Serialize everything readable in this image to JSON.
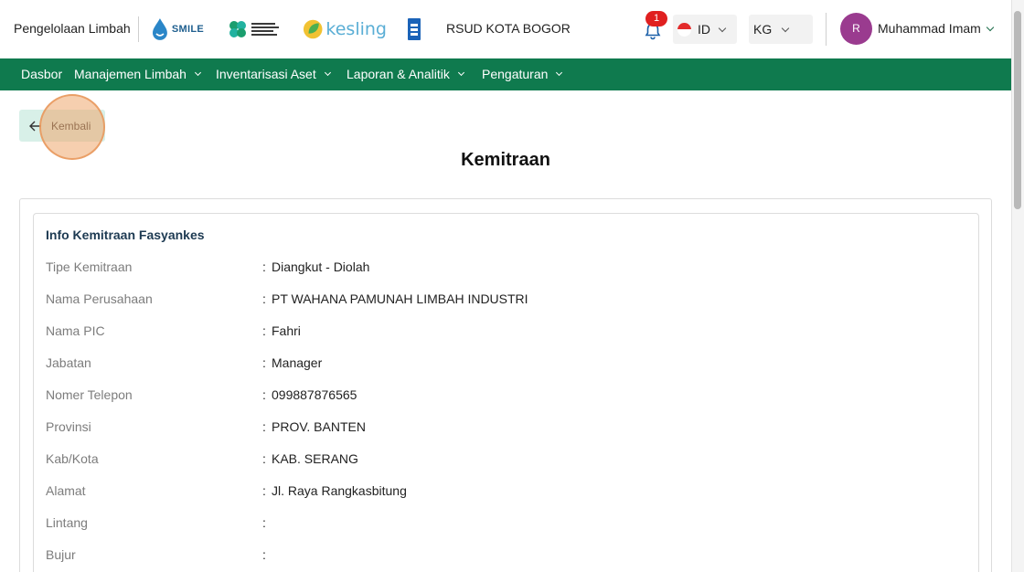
{
  "header": {
    "app_title": "Pengelolaan Limbah",
    "smile_logo_text": "SMILE",
    "kesling_logo_text": "kesling",
    "hospital_name": "RSUD KOTA BOGOR",
    "notification_count": "1",
    "language": "ID",
    "unit": "KG",
    "avatar_initial": "R",
    "user_name": "Muhammad Imam"
  },
  "nav": {
    "items": [
      {
        "label": "Dasbor"
      },
      {
        "label": "Manajemen Limbah"
      },
      {
        "label": "Inventarisasi Aset"
      },
      {
        "label": "Laporan & Analitik"
      },
      {
        "label": "Pengaturan"
      }
    ]
  },
  "back_button": {
    "label": "Kembali"
  },
  "page_title": "Kemitraan",
  "section": {
    "title": "Info Kemitraan Fasyankes",
    "rows": [
      {
        "label": "Tipe Kemitraan",
        "value": "Diangkut - Diolah"
      },
      {
        "label": "Nama Perusahaan",
        "value": "PT WAHANA PAMUNAH LIMBAH INDUSTRI"
      },
      {
        "label": "Nama PIC",
        "value": "Fahri"
      },
      {
        "label": "Jabatan",
        "value": "Manager"
      },
      {
        "label": "Nomer Telepon",
        "value": "099887876565"
      },
      {
        "label": "Provinsi",
        "value": "PROV. BANTEN"
      },
      {
        "label": "Kab/Kota",
        "value": "KAB. SERANG"
      },
      {
        "label": "Alamat",
        "value": "Jl. Raya Rangkasbitung"
      },
      {
        "label": "Lintang",
        "value": ""
      },
      {
        "label": "Bujur",
        "value": ""
      }
    ]
  },
  "colors": {
    "nav_green": "#0f7a4e",
    "back_button_bg": "#d8f0e8",
    "avatar_purple": "#9a3b8f",
    "badge_red": "#e02020",
    "highlight_orange": "#eea86e"
  }
}
